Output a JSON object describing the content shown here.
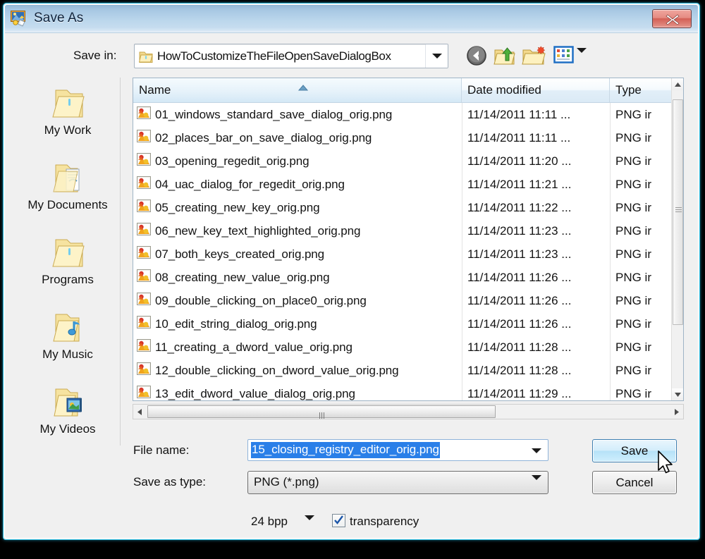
{
  "window": {
    "title": "Save As",
    "icon": "image-save-icon",
    "close_label": "Close",
    "accent_border": "#2fc3e8",
    "titlebar_color": "#bcd7ec"
  },
  "savein": {
    "label": "Save in:",
    "value": "HowToCustomizeTheFileOpenSaveDialogBox",
    "icon": "folder-icon"
  },
  "toolbar": {
    "back": "back-icon",
    "up": "up-one-level-icon",
    "new_folder": "create-new-folder-icon",
    "views": "views-icon"
  },
  "places": {
    "items": [
      {
        "label": "My Work",
        "icon": "folder-icon"
      },
      {
        "label": "My Documents",
        "icon": "documents-folder-icon"
      },
      {
        "label": "Programs",
        "icon": "folder-icon"
      },
      {
        "label": "My Music",
        "icon": "music-folder-icon"
      },
      {
        "label": "My Videos",
        "icon": "videos-folder-icon"
      }
    ]
  },
  "filelist": {
    "columns": [
      "Name",
      "Date modified",
      "Type"
    ],
    "sort_column": "Name",
    "sort_direction": "ascending",
    "rows": [
      {
        "name": "01_windows_standard_save_dialog_orig.png",
        "date": "11/14/2011 11:11 ...",
        "type": "PNG ir"
      },
      {
        "name": "02_places_bar_on_save_dialog_orig.png",
        "date": "11/14/2011 11:11 ...",
        "type": "PNG ir"
      },
      {
        "name": "03_opening_regedit_orig.png",
        "date": "11/14/2011 11:20 ...",
        "type": "PNG ir"
      },
      {
        "name": "04_uac_dialog_for_regedit_orig.png",
        "date": "11/14/2011 11:21 ...",
        "type": "PNG ir"
      },
      {
        "name": "05_creating_new_key_orig.png",
        "date": "11/14/2011 11:22 ...",
        "type": "PNG ir"
      },
      {
        "name": "06_new_key_text_highlighted_orig.png",
        "date": "11/14/2011 11:23 ...",
        "type": "PNG ir"
      },
      {
        "name": "07_both_keys_created_orig.png",
        "date": "11/14/2011 11:23 ...",
        "type": "PNG ir"
      },
      {
        "name": "08_creating_new_value_orig.png",
        "date": "11/14/2011 11:26 ...",
        "type": "PNG ir"
      },
      {
        "name": "09_double_clicking_on_place0_orig.png",
        "date": "11/14/2011 11:26 ...",
        "type": "PNG ir"
      },
      {
        "name": "10_edit_string_dialog_orig.png",
        "date": "11/14/2011 11:26 ...",
        "type": "PNG ir"
      },
      {
        "name": "11_creating_a_dword_value_orig.png",
        "date": "11/14/2011 11:28 ...",
        "type": "PNG ir"
      },
      {
        "name": "12_double_clicking_on_dword_value_orig.png",
        "date": "11/14/2011 11:28 ...",
        "type": "PNG ir"
      },
      {
        "name": "13_edit_dword_value_dialog_orig.png",
        "date": "11/14/2011 11:29 ...",
        "type": "PNG ir"
      }
    ]
  },
  "form": {
    "filename_label": "File name:",
    "filename_value": "15_closing_registry_editor_orig.png",
    "filename_selected": true,
    "savetype_label": "Save as type:",
    "savetype_value": "PNG (*.png)",
    "save_button": "Save",
    "cancel_button": "Cancel"
  },
  "options": {
    "bpp_value": "24 bpp",
    "transparency_label": "transparency",
    "transparency_checked": true
  }
}
